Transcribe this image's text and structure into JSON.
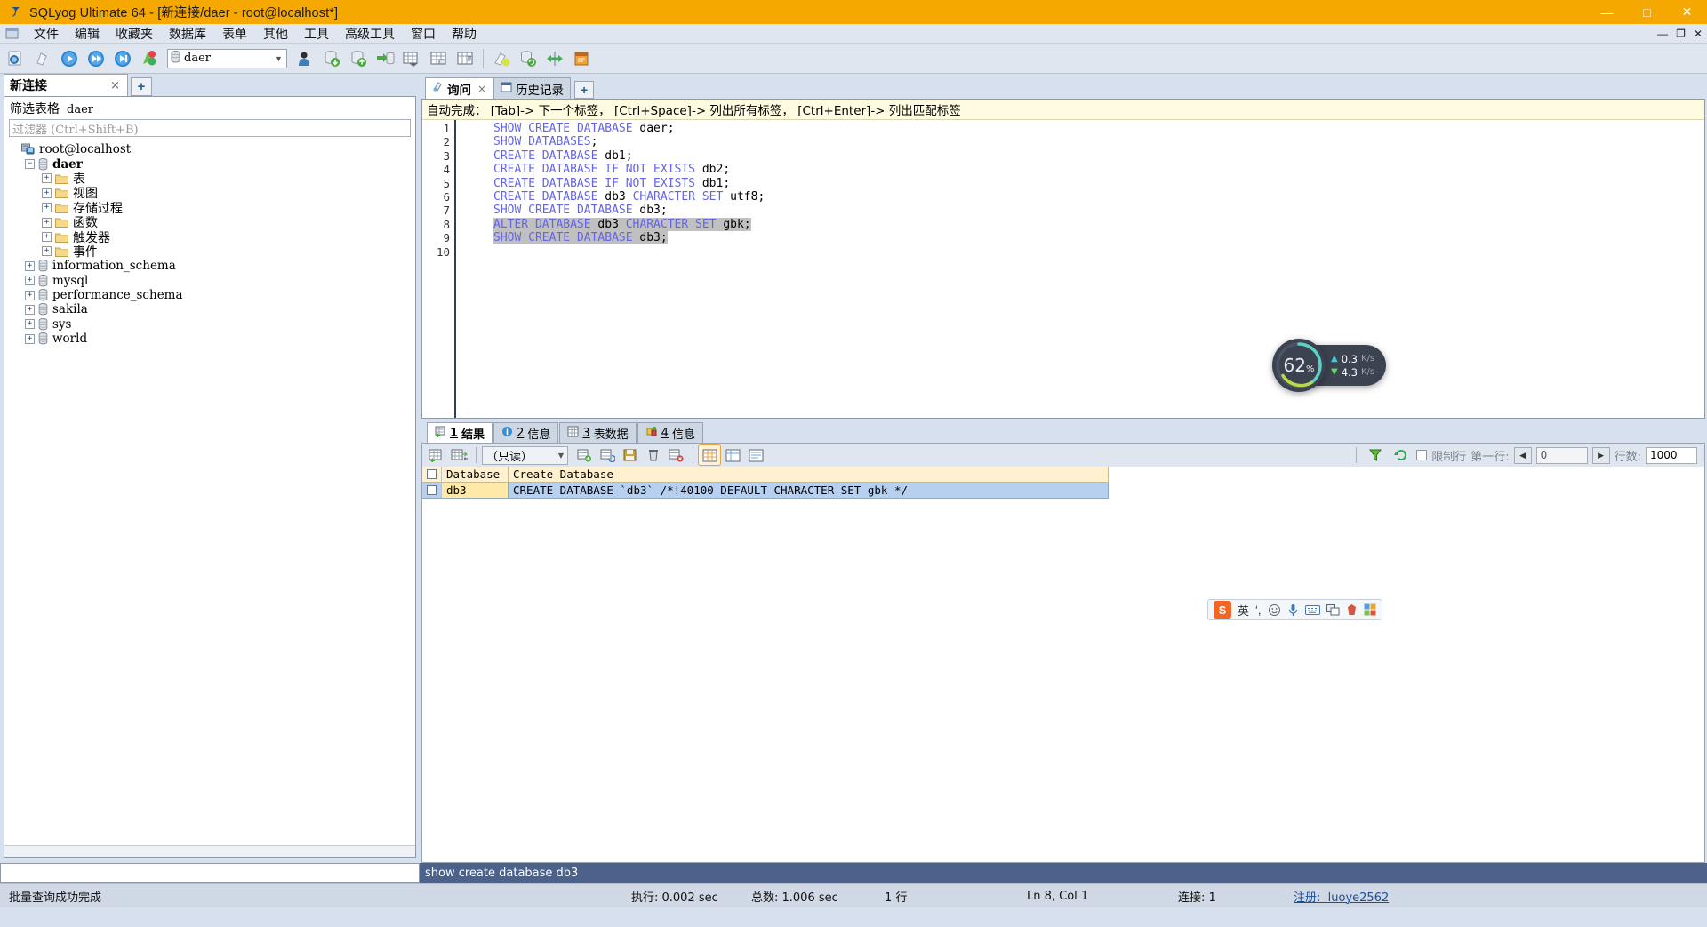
{
  "window": {
    "title": "SQLyog Ultimate 64 - [新连接/daer - root@localhost*]",
    "minimize": "—",
    "maximize": "□",
    "close": "✕",
    "mdi_minimize": "—",
    "mdi_restore": "❐",
    "mdi_close": "✕"
  },
  "menu": {
    "items": [
      "文件",
      "编辑",
      "收藏夹",
      "数据库",
      "表单",
      "其他",
      "工具",
      "高级工具",
      "窗口",
      "帮助"
    ]
  },
  "toolbar": {
    "db_combo_value": "daer",
    "db_combo_arrow": "▼",
    "buttons": [
      "new-connection-icon",
      "new-query-tab-icon",
      "execute-query-icon",
      "execute-all-icon",
      "execute-current-icon",
      "stop-query-icon"
    ],
    "buttons2": [
      "user-manager-icon",
      "db-import-icon",
      "db-export-icon",
      "db-backup-icon",
      "table-data-icon",
      "table-structure-icon",
      "table-info-icon"
    ],
    "buttons3": [
      "schema-designer-icon",
      "db-sync-icon",
      "data-sync-icon",
      "scheduler-icon",
      "sql-formatter-icon",
      "query-builder-icon"
    ]
  },
  "left_panel": {
    "connection_tab": "新连接",
    "connection_tab_close": "×",
    "connection_add": "+",
    "filter_label": "筛选表格",
    "filter_db": "daer",
    "filter_placeholder": "过滤器 (Ctrl+Shift+B)",
    "tree": [
      {
        "label": "root@localhost",
        "icon": "server-icon",
        "expander": "",
        "depth": 0,
        "bold": false,
        "cjk": false
      },
      {
        "label": "daer",
        "icon": "database-icon",
        "expander": "−",
        "depth": 1,
        "bold": true,
        "cjk": false
      },
      {
        "label": "表",
        "icon": "folder-icon",
        "expander": "+",
        "depth": 2,
        "bold": false,
        "cjk": true
      },
      {
        "label": "视图",
        "icon": "folder-icon",
        "expander": "+",
        "depth": 2,
        "bold": false,
        "cjk": true
      },
      {
        "label": "存储过程",
        "icon": "folder-icon",
        "expander": "+",
        "depth": 2,
        "bold": false,
        "cjk": true
      },
      {
        "label": "函数",
        "icon": "folder-icon",
        "expander": "+",
        "depth": 2,
        "bold": false,
        "cjk": true
      },
      {
        "label": "触发器",
        "icon": "folder-icon",
        "expander": "+",
        "depth": 2,
        "bold": false,
        "cjk": true
      },
      {
        "label": "事件",
        "icon": "folder-icon",
        "expander": "+",
        "depth": 2,
        "bold": false,
        "cjk": true
      },
      {
        "label": "information_schema",
        "icon": "database-icon",
        "expander": "+",
        "depth": 1,
        "bold": false,
        "cjk": false
      },
      {
        "label": "mysql",
        "icon": "database-icon",
        "expander": "+",
        "depth": 1,
        "bold": false,
        "cjk": false
      },
      {
        "label": "performance_schema",
        "icon": "database-icon",
        "expander": "+",
        "depth": 1,
        "bold": false,
        "cjk": false
      },
      {
        "label": "sakila",
        "icon": "database-icon",
        "expander": "+",
        "depth": 1,
        "bold": false,
        "cjk": false
      },
      {
        "label": "sys",
        "icon": "database-icon",
        "expander": "+",
        "depth": 1,
        "bold": false,
        "cjk": false
      },
      {
        "label": "world",
        "icon": "database-icon",
        "expander": "+",
        "depth": 1,
        "bold": false,
        "cjk": false
      }
    ]
  },
  "editor": {
    "tabs": [
      {
        "label": "询问",
        "icon": "query-icon",
        "active": true,
        "close": "×"
      },
      {
        "label": "历史记录",
        "icon": "history-icon",
        "active": false,
        "close": ""
      }
    ],
    "add_tab": "+",
    "autocomplete_hint": "自动完成： [Tab]-> 下一个标签， [Ctrl+Space]-> 列出所有标签， [Ctrl+Enter]-> 列出匹配标签",
    "lines": [
      {
        "n": "1",
        "text": "SHOW CREATE DATABASE daer;",
        "selected": false
      },
      {
        "n": "2",
        "text": "SHOW DATABASES;",
        "selected": false
      },
      {
        "n": "3",
        "text": "CREATE DATABASE db1;",
        "selected": false
      },
      {
        "n": "4",
        "text": "CREATE DATABASE IF NOT EXISTS db2;",
        "selected": false
      },
      {
        "n": "5",
        "text": "CREATE DATABASE IF NOT EXISTS db1;",
        "selected": false
      },
      {
        "n": "6",
        "text": "CREATE DATABASE db3 CHARACTER SET utf8;",
        "selected": false
      },
      {
        "n": "7",
        "text": "SHOW CREATE DATABASE db3;",
        "selected": false
      },
      {
        "n": "8",
        "text": "ALTER DATABASE db3 CHARACTER SET gbk;",
        "selected": true
      },
      {
        "n": "9",
        "text": "SHOW CREATE DATABASE db3;",
        "selected": true
      },
      {
        "n": "10",
        "text": "",
        "selected": false
      }
    ],
    "keywords": [
      "SHOW",
      "CREATE",
      "DATABASE",
      "DATABASES",
      "IF",
      "NOT",
      "EXISTS",
      "CHARACTER",
      "SET",
      "ALTER"
    ]
  },
  "results": {
    "tabs": [
      {
        "num": "1",
        "label": "结果",
        "icon": "result-grid-icon",
        "active": true
      },
      {
        "num": "2",
        "label": "信息",
        "icon": "info-icon",
        "active": false
      },
      {
        "num": "3",
        "label": "表数据",
        "icon": "table-data-icon",
        "active": false
      },
      {
        "num": "4",
        "label": "信息",
        "icon": "objects-info-icon",
        "active": false
      }
    ],
    "toolbar": {
      "mode_value": "（只读）",
      "mode_arrow": "▼",
      "limit_label": "限制行",
      "first_row_label": "第一行:",
      "first_row_value": "0",
      "row_count_label": "行数:",
      "row_count_value": "1000",
      "prev_arrow": "◀",
      "next_arrow": "▶",
      "icons": [
        "grid-view-icon",
        "grid-export-icon",
        "add-row-icon",
        "refresh-row-icon",
        "save-row-icon",
        "delete-row-icon",
        "discard-row-icon",
        "grid-mode-icon",
        "form-mode-icon",
        "text-mode-icon",
        "filter-icon",
        "refresh-icon"
      ]
    },
    "columns": [
      "Database",
      "Create Database"
    ],
    "rows": [
      {
        "Database": "db3",
        "Create Database": "CREATE DATABASE `db3` /*!40100 DEFAULT CHARACTER SET gbk */"
      }
    ]
  },
  "history_line": "show create database db3",
  "statusbar": {
    "message": "批量查询成功完成",
    "exec_time": "执行: 0.002 sec",
    "total_time": "总数: 1.006 sec",
    "rows": "1 行",
    "cursor": "Ln 8, Col 1",
    "connection": "连接: 1",
    "register_label": "注册:",
    "register_user": "luoye2562"
  },
  "net_widget": {
    "percent": "62",
    "percent_unit": "%",
    "upload": "0.3",
    "upload_unit": "K/s",
    "download": "4.3",
    "download_unit": "K/s",
    "up_arrow": "▲",
    "down_arrow": "▼"
  },
  "ime_bar": {
    "logo": "S",
    "lang": "英",
    "items": [
      "punctuation-icon",
      "emoji-icon",
      "voice-icon",
      "keyboard-icon",
      "translate-icon",
      "skin-icon",
      "toolbox-icon"
    ]
  },
  "colors": {
    "title_bg": "#f5a800",
    "keyword": "#6464e6",
    "selection": "#c0c0c0",
    "grid_header": "#fff0cf",
    "grid_row": "#b8d0f0"
  }
}
